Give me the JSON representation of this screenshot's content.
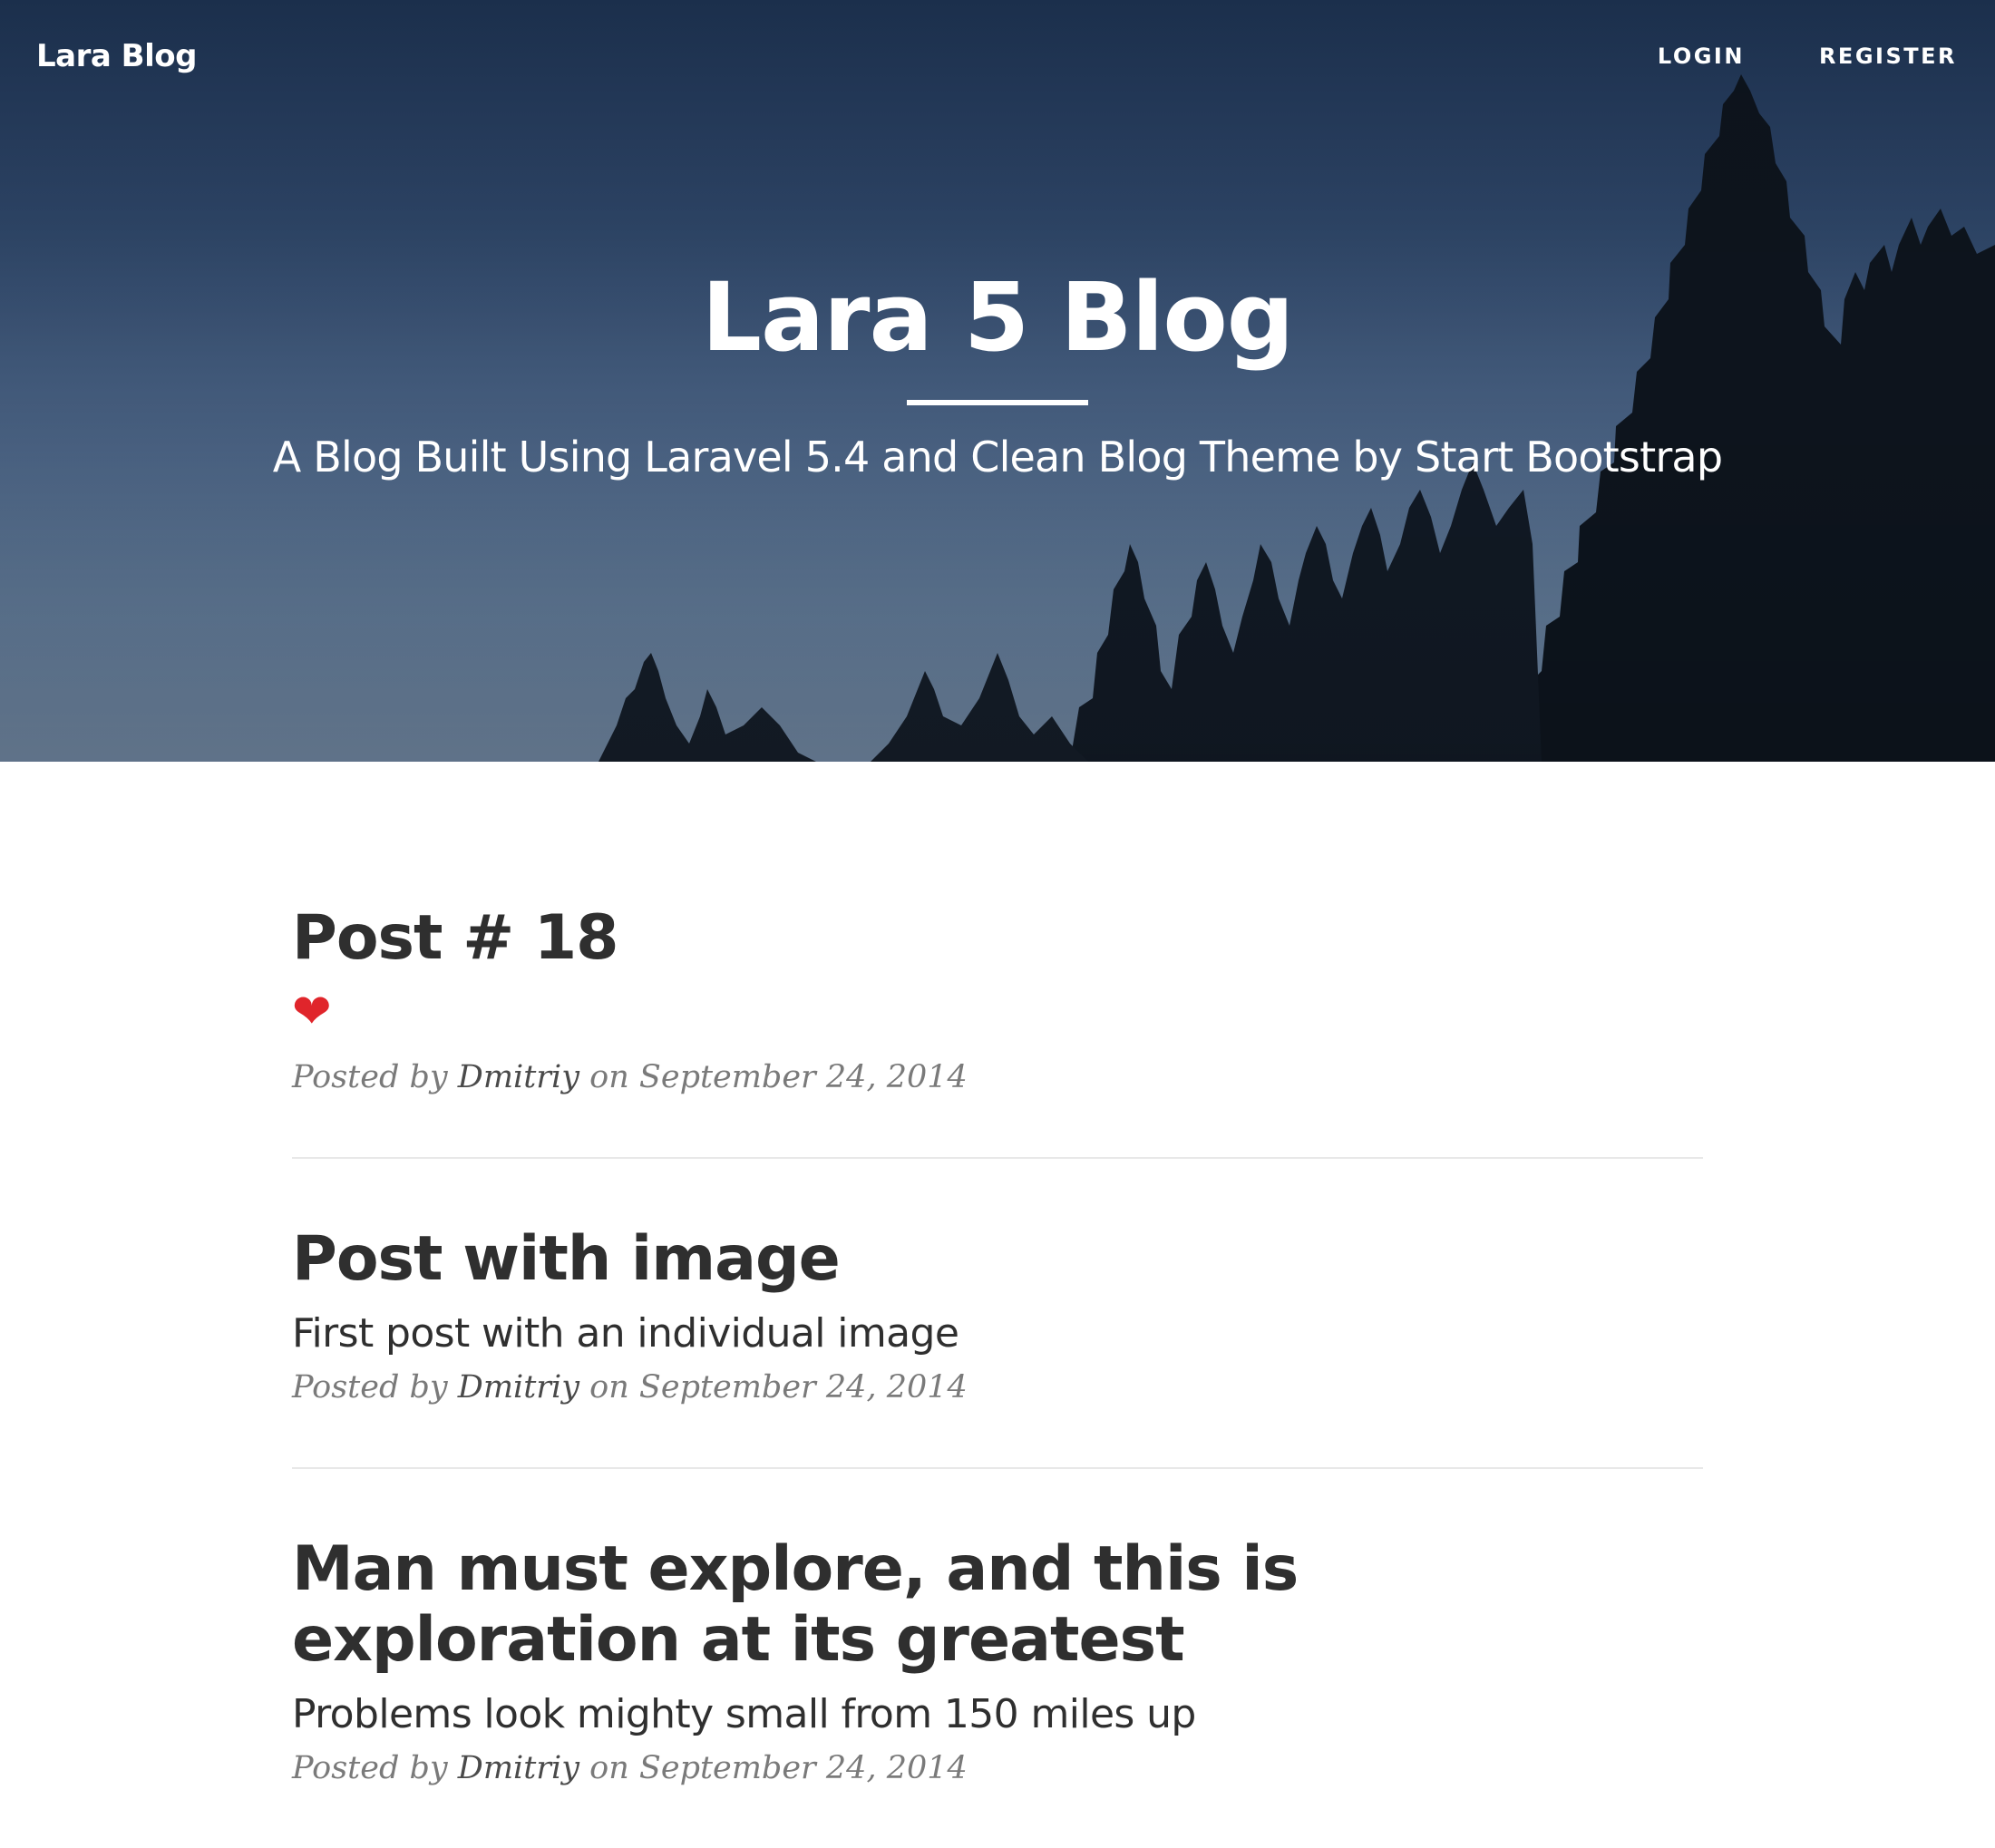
{
  "navbar": {
    "brand": "Lara Blog",
    "links": [
      {
        "label": "LOGIN"
      },
      {
        "label": "REGISTER"
      }
    ]
  },
  "hero": {
    "title": "Lara 5 Blog",
    "subtitle": "A Blog Built Using Laravel 5.4 and Clean Blog Theme by Start Bootstrap",
    "background": "night sky with pine tree silhouettes"
  },
  "posts": [
    {
      "title": "Post # 18",
      "subtitle_icon": "heart-emoji",
      "meta_prefix": "Posted by ",
      "author": "Dmitriy",
      "meta_mid": " on ",
      "date": "September 24, 2014"
    },
    {
      "title": "Post with image",
      "subtitle": "First post with an individual image",
      "meta_prefix": "Posted by ",
      "author": "Dmitriy",
      "meta_mid": " on ",
      "date": "September 24, 2014"
    },
    {
      "title": "Man must explore, and this is exploration at its greatest",
      "subtitle": "Problems look mighty small from 150 miles up",
      "meta_prefix": "Posted by ",
      "author": "Dmitriy",
      "meta_mid": " on ",
      "date": "September 24, 2014"
    }
  ],
  "colors": {
    "heading": "#2f2f2f",
    "meta": "#7a7a7a",
    "heart": "#e0252b",
    "hero_text": "#ffffff"
  }
}
